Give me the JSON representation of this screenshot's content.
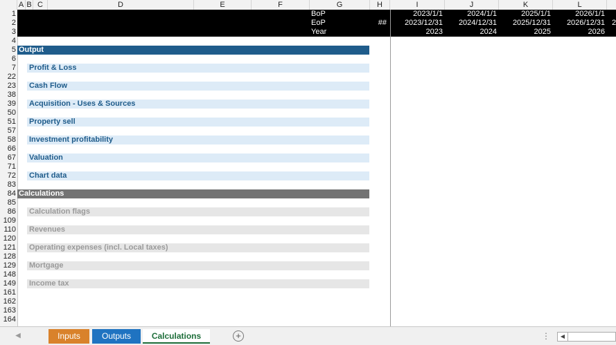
{
  "columns": [
    "A",
    "B",
    "C",
    "D",
    "E",
    "F",
    "G",
    "H",
    "I",
    "J",
    "K",
    "L"
  ],
  "rows": [
    "1",
    "2",
    "3",
    "4",
    "5",
    "6",
    "7",
    "22",
    "23",
    "38",
    "39",
    "50",
    "51",
    "57",
    "58",
    "66",
    "67",
    "71",
    "72",
    "83",
    "84",
    "85",
    "86",
    "109",
    "110",
    "120",
    "121",
    "128",
    "129",
    "148",
    "149",
    "161",
    "162",
    "163",
    "164"
  ],
  "header_band": {
    "labels": [
      "BoP",
      "EoP",
      "Year"
    ],
    "h_marker": "##",
    "periods": [
      {
        "bop": "2023/1/1",
        "eop": "2023/12/31",
        "year": "2023"
      },
      {
        "bop": "2024/1/1",
        "eop": "2024/12/31",
        "year": "2024"
      },
      {
        "bop": "2025/1/1",
        "eop": "2025/12/31",
        "year": "2025"
      },
      {
        "bop": "2026/1/1",
        "eop": "2026/12/31",
        "year": "2026"
      }
    ],
    "overflow_digit": "2"
  },
  "sections": {
    "output": {
      "title": "Output",
      "color": "#1f5c8b",
      "items": [
        "Profit & Loss",
        "Cash Flow",
        "Acquisition - Uses & Sources",
        "Property sell",
        "Investment profitability",
        "Valuation",
        "Chart data"
      ]
    },
    "calculations": {
      "title": "Calculations",
      "color": "#737373",
      "items": [
        "Calculation flags",
        "Revenues",
        "Operating expenses (incl. Local taxes)",
        "Mortgage",
        "Income tax"
      ]
    }
  },
  "sheet_tabs": [
    {
      "label": "Inputs",
      "bg": "#d9822b",
      "fg": "#ffffff"
    },
    {
      "label": "Outputs",
      "bg": "#1f73c1",
      "fg": "#ffffff"
    },
    {
      "label": "Calculations",
      "bg": "#ffffff",
      "fg": "#1e6e3a",
      "active": true
    }
  ],
  "icons": {
    "nav_left": "triangle-left-icon",
    "add_sheet": "plus-circle-icon",
    "more": "vertical-dots-icon",
    "scroll_left": "triangle-left-icon"
  }
}
